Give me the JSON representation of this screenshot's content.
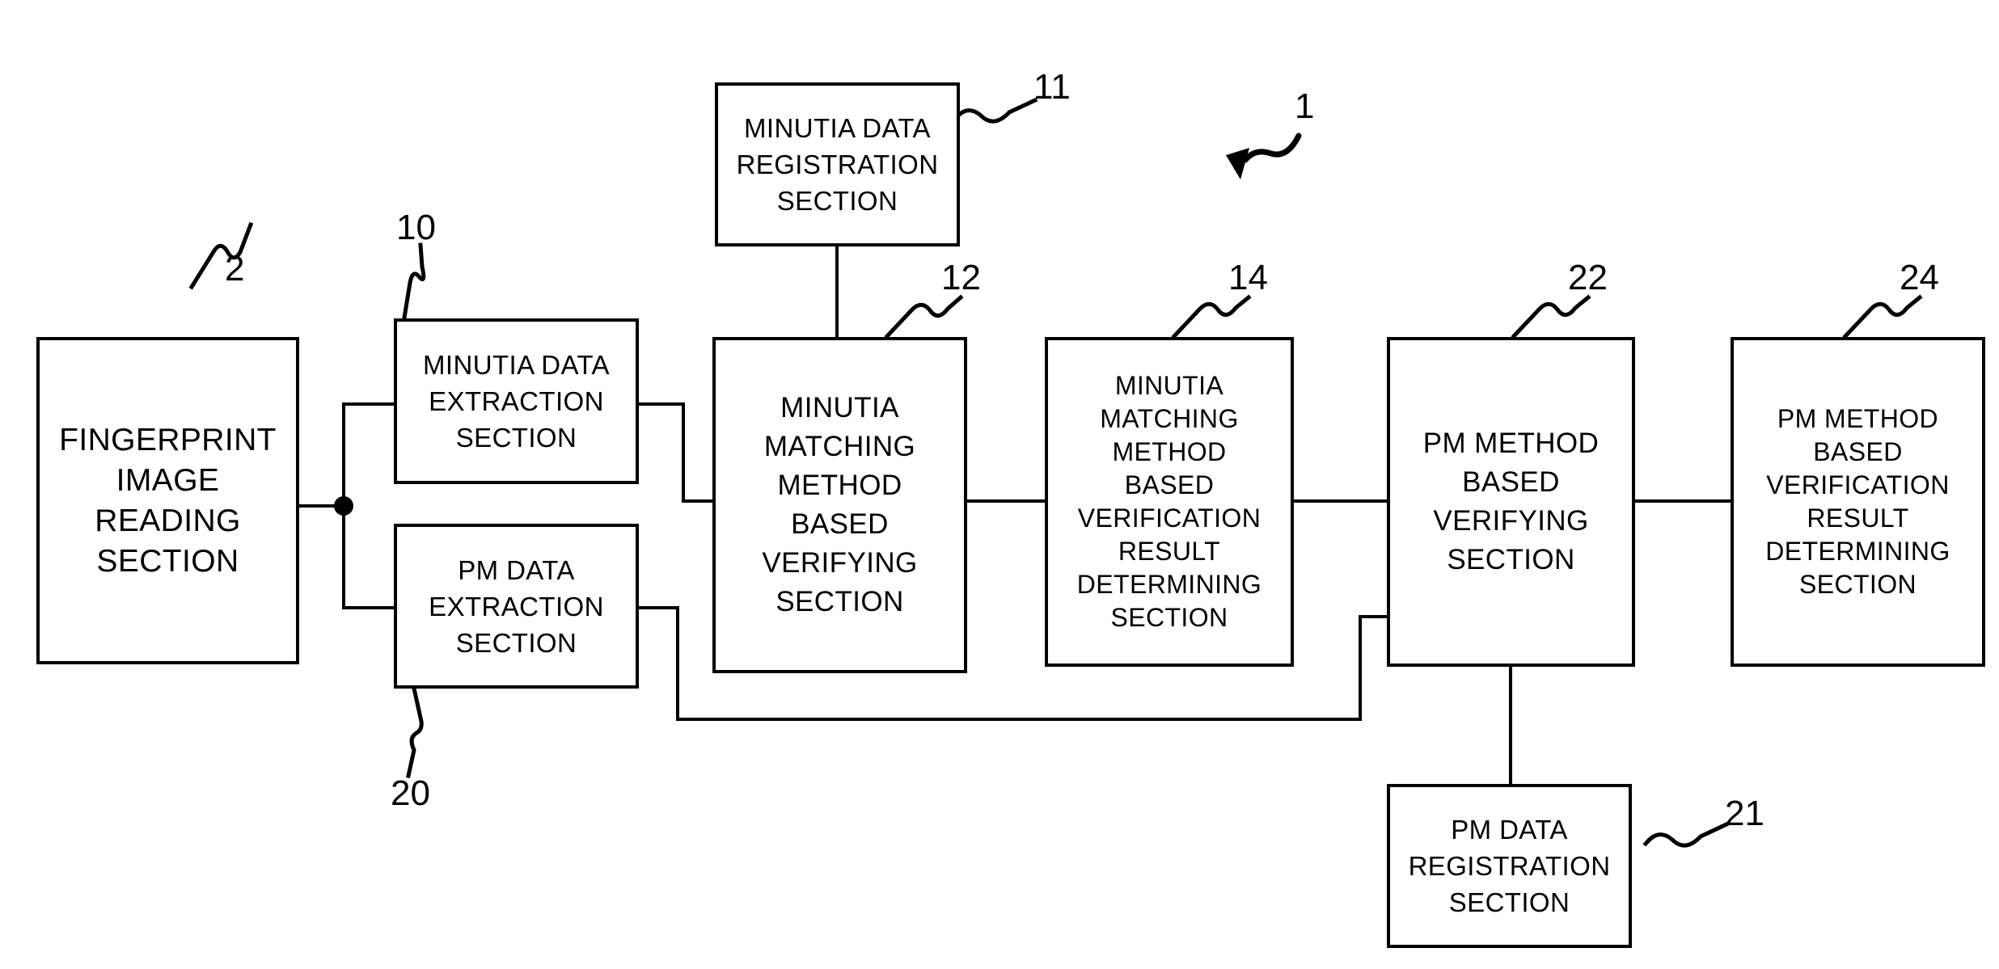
{
  "figure": {
    "kind": "patent-block-diagram",
    "system_reference": "1",
    "colors": {
      "line": "#000000",
      "background": "#ffffff",
      "text": "#000000"
    }
  },
  "blocks": [
    {
      "id": "fingerprint-image-reading-section",
      "ref": "2",
      "lines": [
        "FINGERPRINT",
        "IMAGE",
        "READING",
        "SECTION"
      ]
    },
    {
      "id": "minutia-data-extraction-section",
      "ref": "10",
      "lines": [
        "MINUTIA DATA",
        "EXTRACTION",
        "SECTION"
      ]
    },
    {
      "id": "pm-data-extraction-section",
      "ref": "20",
      "lines": [
        "PM DATA",
        "EXTRACTION",
        "SECTION"
      ]
    },
    {
      "id": "minutia-data-registration-section",
      "ref": "11",
      "lines": [
        "MINUTIA DATA",
        "REGISTRATION",
        "SECTION"
      ]
    },
    {
      "id": "minutia-matching-method-based-verifying-section",
      "ref": "12",
      "lines": [
        "MINUTIA",
        "MATCHING",
        "METHOD",
        "BASED",
        "VERIFYING",
        "SECTION"
      ]
    },
    {
      "id": "minutia-matching-method-based-verification-result-determining-section",
      "ref": "14",
      "lines": [
        "MINUTIA",
        "MATCHING",
        "METHOD",
        "BASED",
        "VERIFICATION",
        "RESULT",
        "DETERMINING",
        "SECTION"
      ]
    },
    {
      "id": "pm-method-based-verifying-section",
      "ref": "22",
      "lines": [
        "PM METHOD",
        "BASED",
        "VERIFYING",
        "SECTION"
      ]
    },
    {
      "id": "pm-method-based-verification-result-determining-section",
      "ref": "24",
      "lines": [
        "PM METHOD",
        "BASED",
        "VERIFICATION",
        "RESULT",
        "DETERMINING",
        "SECTION"
      ]
    },
    {
      "id": "pm-data-registration-section",
      "ref": "21",
      "lines": [
        "PM DATA",
        "REGISTRATION",
        "SECTION"
      ]
    }
  ]
}
